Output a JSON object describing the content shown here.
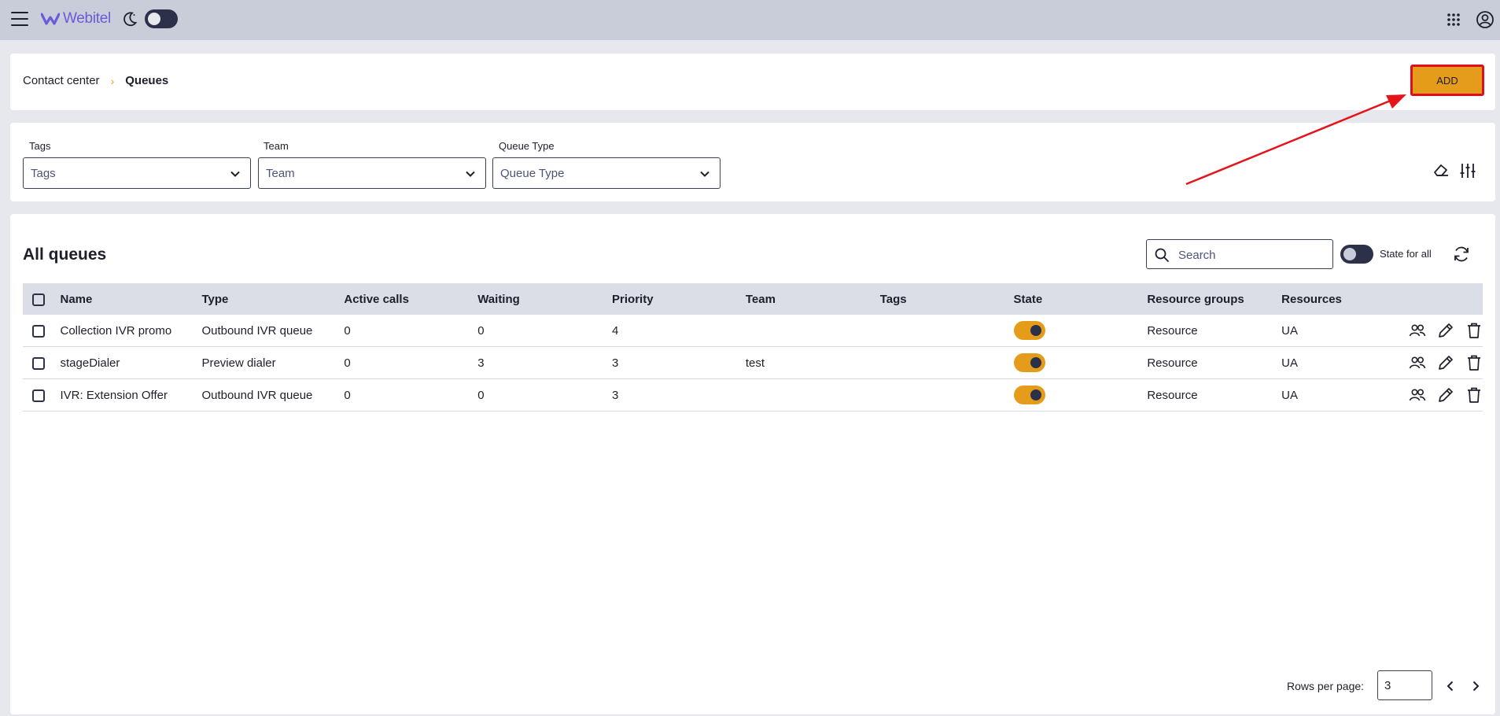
{
  "topbar": {
    "logo_text": "Webitel",
    "brand_color": "#6b5bd6",
    "icons": [
      "menu-icon",
      "moon-icon",
      "apps-grid-icon",
      "account-icon"
    ]
  },
  "header": {
    "breadcrumb_parent": "Contact center",
    "breadcrumb_separator": "›",
    "breadcrumb_current": "Queues",
    "add_label": "ADD",
    "add_color": "#e59c1a"
  },
  "filters": {
    "tags_label": "Tags",
    "tags_placeholder": "Tags",
    "team_label": "Team",
    "team_placeholder": "Team",
    "queue_type_label": "Queue Type",
    "queue_type_placeholder": "Queue Type"
  },
  "main": {
    "title": "All queues",
    "search_placeholder": "Search",
    "state_for_all_label": "State for all",
    "columns": [
      "Name",
      "Type",
      "Active calls",
      "Waiting",
      "Priority",
      "Team",
      "Tags",
      "State",
      "Resource groups",
      "Resources"
    ],
    "rows": [
      {
        "name": "Collection IVR promo",
        "type": "Outbound IVR queue",
        "active_calls": "0",
        "waiting": "0",
        "priority": "4",
        "team": "",
        "tags": "",
        "state": true,
        "resource_groups": "Resource",
        "resources": "UA"
      },
      {
        "name": "stageDialer",
        "type": "Preview dialer",
        "active_calls": "0",
        "waiting": "3",
        "priority": "3",
        "team": "test",
        "tags": "",
        "state": true,
        "resource_groups": "Resource",
        "resources": "UA"
      },
      {
        "name": "IVR: Extension Offer",
        "type": "Outbound IVR queue",
        "active_calls": "0",
        "waiting": "0",
        "priority": "3",
        "team": "",
        "tags": "",
        "state": true,
        "resource_groups": "Resource",
        "resources": "UA"
      }
    ],
    "toggle_on_color": "#e59c1a"
  },
  "pagination": {
    "rows_per_page_label": "Rows per page:",
    "rows_per_page_value": "3"
  }
}
